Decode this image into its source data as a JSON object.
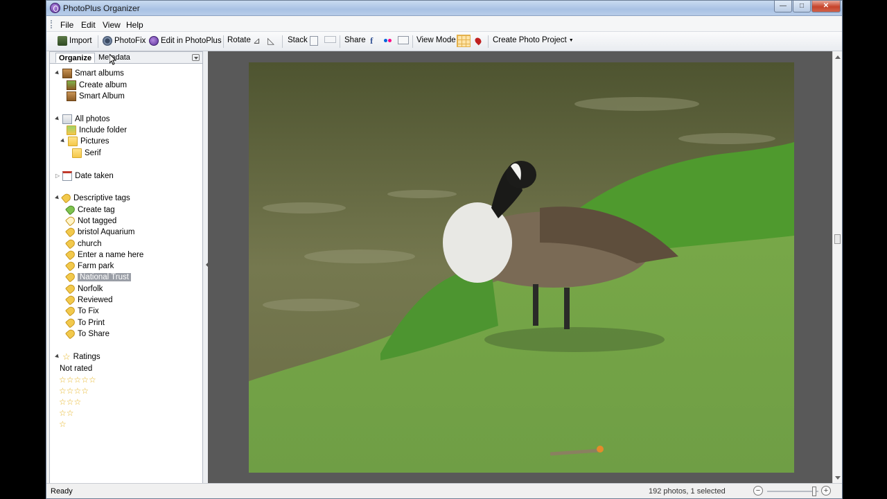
{
  "window": {
    "title": "PhotoPlus Organizer"
  },
  "menu": [
    "File",
    "Edit",
    "View",
    "Help"
  ],
  "toolbar": {
    "import": "Import",
    "photofix": "PhotoFix",
    "edit_photoplus": "Edit in PhotoPlus",
    "rotate": "Rotate",
    "stack": "Stack",
    "share": "Share",
    "view_mode": "View Mode",
    "create_project": "Create Photo Project"
  },
  "panel": {
    "tabs": [
      "Organize",
      "Metadata"
    ],
    "smart_albums": {
      "label": "Smart albums",
      "items": [
        "Create album",
        "Smart Album"
      ]
    },
    "all_photos": {
      "label": "All photos",
      "include_folder": "Include folder",
      "pictures": "Pictures",
      "serif": "Serif"
    },
    "date_taken": "Date taken",
    "tags": {
      "label": "Descriptive tags",
      "items": [
        "Create tag",
        "Not tagged",
        "bristol Aquarium",
        "church",
        "Enter a name here",
        "Farm park",
        "National Trust",
        "Norfolk",
        "Reviewed",
        "To Fix",
        "To Print",
        "To Share"
      ],
      "selected": "National Trust"
    },
    "ratings": {
      "label": "Ratings",
      "not_rated": "Not rated",
      "levels": [
        5,
        4,
        3,
        2,
        1
      ]
    }
  },
  "status": {
    "left": "Ready",
    "right": "192 photos, 1 selected"
  },
  "colors": {
    "accent": "#9a9ea6",
    "tag": "#f2c94c",
    "viewer_bg": "#595959"
  }
}
